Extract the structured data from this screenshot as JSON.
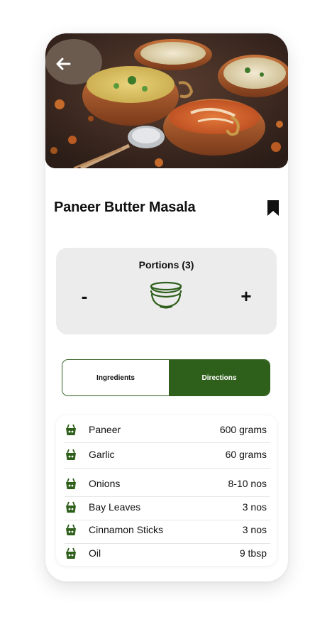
{
  "recipe": {
    "title": "Paneer Butter Masala"
  },
  "portions": {
    "label": "Portions (3)",
    "minus_label": "-",
    "plus_label": "+"
  },
  "tabs": {
    "ingredients_label": "Ingredients",
    "directions_label": "Directions",
    "active": "Directions"
  },
  "ingredients": [
    {
      "name": "Paneer",
      "qty": "600 grams"
    },
    {
      "name": "Garlic",
      "qty": "60 grams"
    },
    {
      "name": "Onions",
      "qty": "8-10 nos"
    },
    {
      "name": "Bay Leaves",
      "qty": "3 nos"
    },
    {
      "name": "Cinnamon Sticks",
      "qty": "3 nos"
    },
    {
      "name": "Oil",
      "qty": "9 tbsp"
    }
  ],
  "icons": {
    "back": "back-arrow-icon",
    "bookmark": "bookmark-icon",
    "bowl": "bowl-icon",
    "ingredient": "grocery-basket-icon"
  },
  "colors": {
    "accent": "#2e5f1b",
    "card_bg": "#ececec"
  }
}
